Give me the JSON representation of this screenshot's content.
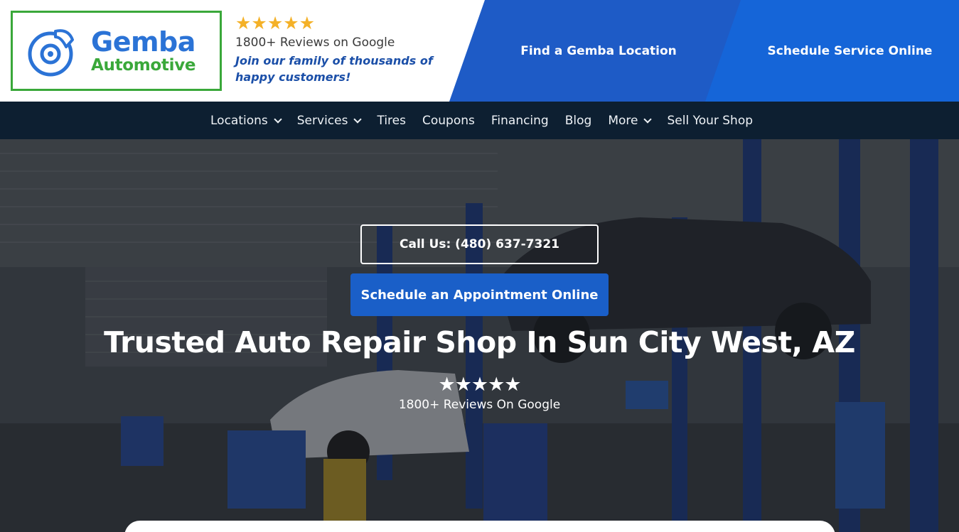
{
  "header": {
    "logo": {
      "brand": "Gemba",
      "sub": "Automotive",
      "icon": "brake-disc-icon",
      "brand_color": "#2b73d6",
      "sub_color": "#3aa83a"
    },
    "rating_stars": "★★★★★",
    "reviews_text": "1800+ Reviews on Google",
    "join_text": "Join our family of thousands of happy customers!",
    "find_location": "Find a Gemba Location",
    "schedule_service": "Schedule Service Online"
  },
  "nav": {
    "items": [
      {
        "label": "Locations",
        "dropdown": true
      },
      {
        "label": "Services",
        "dropdown": true
      },
      {
        "label": "Tires",
        "dropdown": false
      },
      {
        "label": "Coupons",
        "dropdown": false
      },
      {
        "label": "Financing",
        "dropdown": false
      },
      {
        "label": "Blog",
        "dropdown": false
      },
      {
        "label": "More",
        "dropdown": true
      },
      {
        "label": "Sell Your Shop",
        "dropdown": false
      }
    ]
  },
  "hero": {
    "call_button": "Call Us: (480) 637-7321",
    "schedule_button": "Schedule an Appointment Online",
    "title": "Trusted Auto Repair Shop In Sun City West, AZ",
    "stars": "★★★★★",
    "reviews": "1800+ Reviews On Google"
  },
  "colors": {
    "nav_bg": "#0d1f31",
    "cta_blue": "#1e5bc6",
    "accent_blue": "#1a5fc8",
    "star_gold": "#f4b128"
  }
}
